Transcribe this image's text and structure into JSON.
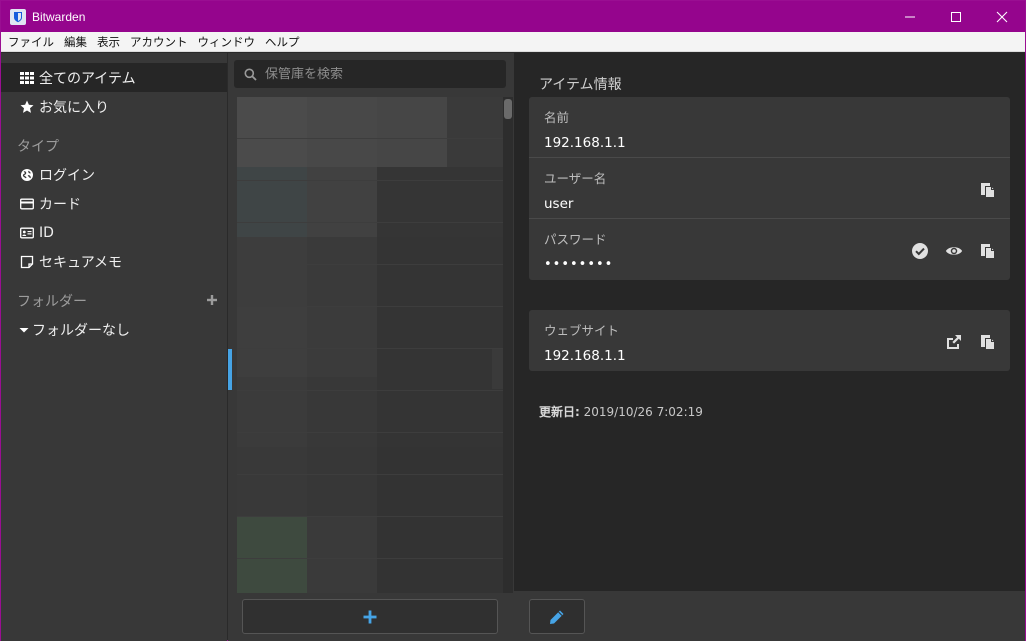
{
  "window": {
    "title": "Bitwarden"
  },
  "menu": [
    "ファイル",
    "編集",
    "表示",
    "アカウント",
    "ウィンドウ",
    "ヘルプ"
  ],
  "nav": {
    "all_items": "全てのアイテム",
    "favorites": "お気に入り",
    "types_heading": "タイプ",
    "types": {
      "login": "ログイン",
      "card": "カード",
      "identity": "ID",
      "secure_note": "セキュアメモ"
    },
    "folders_heading": "フォルダー",
    "no_folder": "フォルダーなし"
  },
  "search": {
    "placeholder": "保管庫を検索"
  },
  "detail": {
    "section_title": "アイテム情報",
    "name_label": "名前",
    "name_value": "192.168.1.1",
    "username_label": "ユーザー名",
    "username_value": "user",
    "password_label": "パスワード",
    "password_value": "••••••••",
    "website_label": "ウェブサイト",
    "website_value": "192.168.1.1",
    "updated_label": "更新日:",
    "updated_value": "2019/10/26 7:02:19"
  },
  "colors": {
    "titlebar": "#95058d",
    "accent": "#46a4e6",
    "panel": "#383838",
    "detail_bg": "#262626"
  }
}
